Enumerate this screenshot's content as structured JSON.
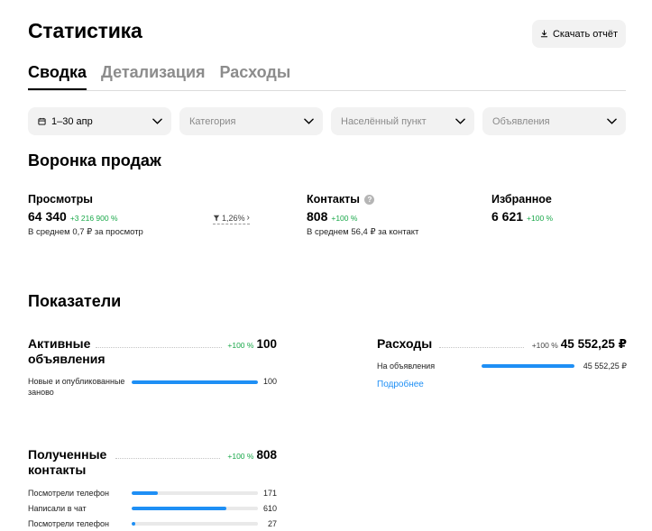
{
  "header": {
    "title": "Статистика",
    "download_label": "Скачать отчёт"
  },
  "tabs": [
    {
      "label": "Сводка",
      "active": true
    },
    {
      "label": "Детализация",
      "active": false
    },
    {
      "label": "Расходы",
      "active": false
    }
  ],
  "filters": {
    "period": "1–30 апр",
    "category": "Категория",
    "location": "Населённый пункт",
    "listings": "Объявления"
  },
  "funnel": {
    "title": "Воронка продаж",
    "views": {
      "label": "Просмотры",
      "value": "64 340",
      "delta": "+3 216 900 %",
      "sub": "В среднем 0,7 ₽ за просмотр"
    },
    "conversion": {
      "value": "1,26%",
      "arrow": "›"
    },
    "contacts": {
      "label": "Контакты",
      "help": "?",
      "value": "808",
      "delta": "+100 %",
      "sub": "В среднем 56,4 ₽ за контакт"
    },
    "favorites": {
      "label": "Избранное",
      "value": "6 621",
      "delta": "+100 %"
    }
  },
  "indicators": {
    "title": "Показатели",
    "active_listings": {
      "title": "Активные объявления",
      "delta": "+100 %",
      "value": "100",
      "rows": [
        {
          "label": "Новые и опубликованные заново",
          "value": "100",
          "fill": 1.0
        }
      ]
    },
    "contacts": {
      "title": "Полученные контакты",
      "delta": "+100 %",
      "value": "808",
      "rows": [
        {
          "label": "Посмотрели телефон",
          "value": "171",
          "fill": 0.21
        },
        {
          "label": "Написали в чат",
          "value": "610",
          "fill": 0.75
        },
        {
          "label": "Посмотрели телефон",
          "value": "27",
          "fill": 0.03
        }
      ]
    },
    "expenses": {
      "title": "Расходы",
      "delta": "+100 %",
      "value": "45 552,25 ₽",
      "rows": [
        {
          "label": "На объявления",
          "value": "45 552,25 ₽",
          "fill": 1.0
        }
      ],
      "more": "Подробнее"
    }
  },
  "colors": {
    "accent_blue": "#1e8ff5",
    "positive_green": "#1aa84a",
    "chip_bg": "#f2f2f2"
  },
  "icons": {
    "download": "download-icon",
    "calendar": "calendar-icon",
    "chevron": "chevron-down-icon",
    "filter": "funnel-icon",
    "help": "help-icon"
  }
}
